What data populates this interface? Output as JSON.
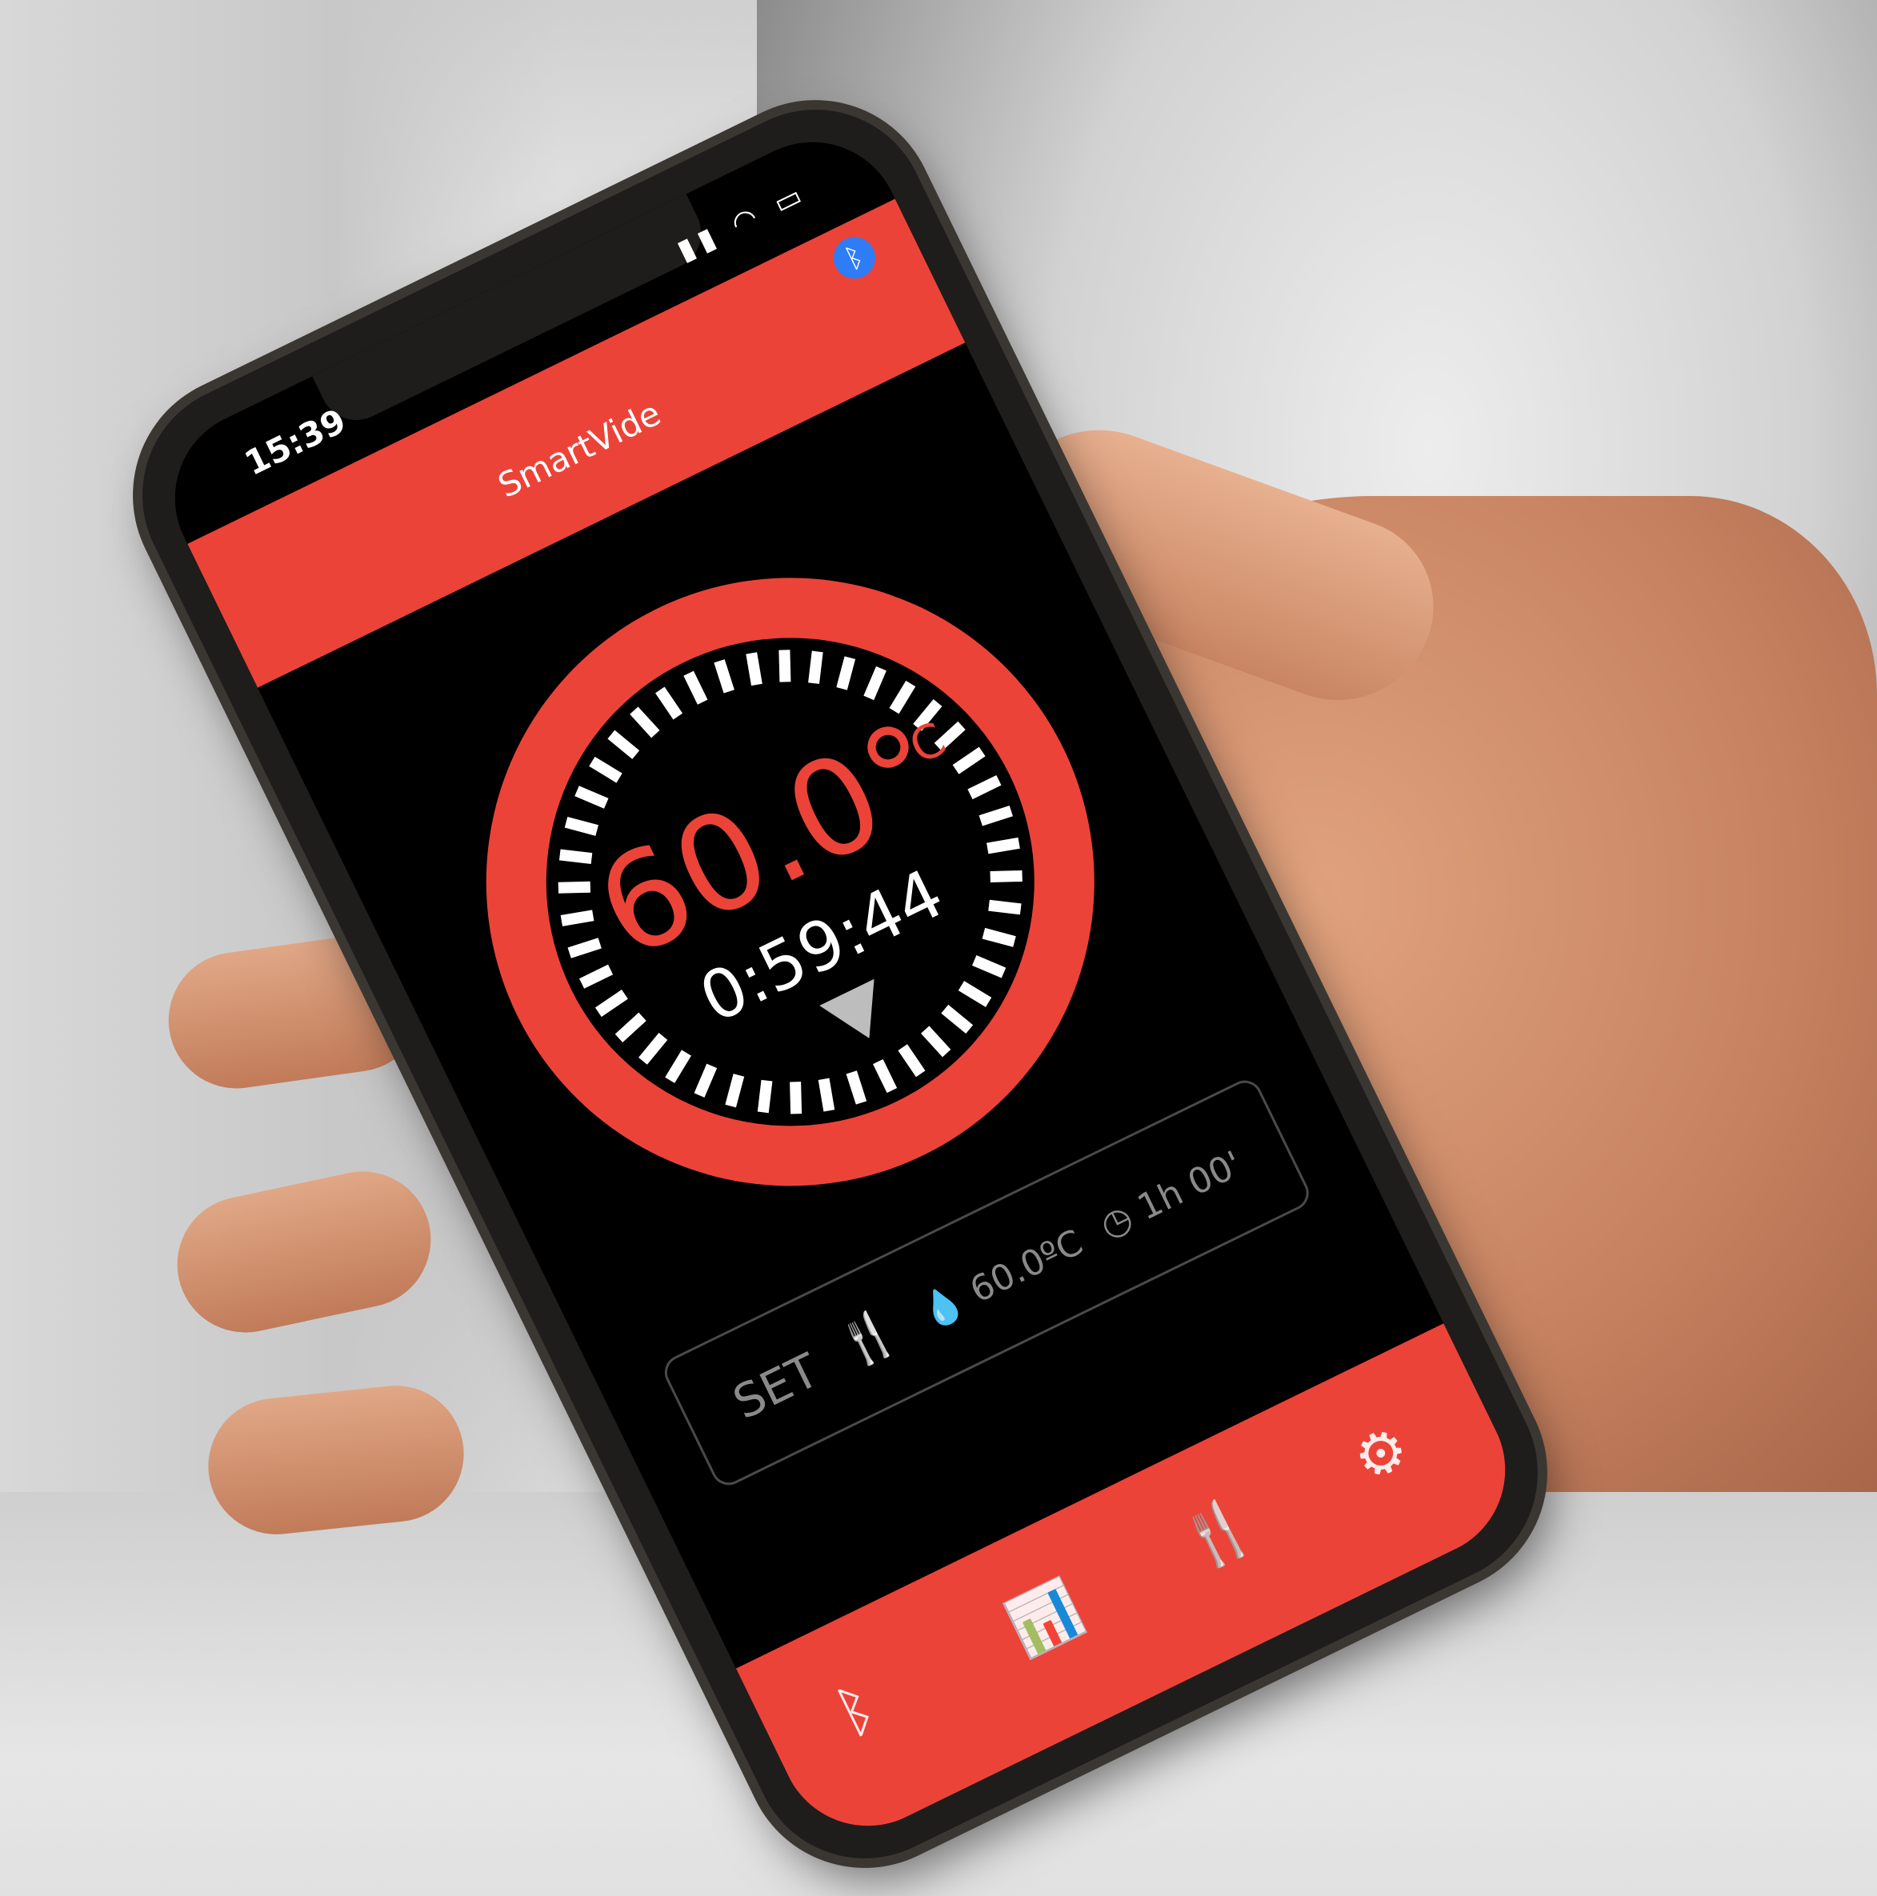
{
  "status_bar": {
    "time": "15:39",
    "icons": "▮▮ ◠ ▭"
  },
  "header": {
    "title": "SmartVide",
    "bluetooth_icon": "bluetooth-icon"
  },
  "dial": {
    "temperature": "60.0°",
    "unit": "C",
    "timer": "0:59:44"
  },
  "set_panel": {
    "label": "SET",
    "fork_icon": "🍴",
    "target_temperature": "60.0ºC",
    "target_time": "1h 00'"
  },
  "tabs": [
    {
      "name": "bluetooth",
      "glyph": "ᛒ"
    },
    {
      "name": "stats",
      "glyph": "📊"
    },
    {
      "name": "recipes",
      "glyph": "🍴"
    },
    {
      "name": "settings",
      "glyph": "⚙"
    }
  ],
  "colors": {
    "accent": "#ec4339",
    "bluetooth": "#2e7cf6"
  }
}
